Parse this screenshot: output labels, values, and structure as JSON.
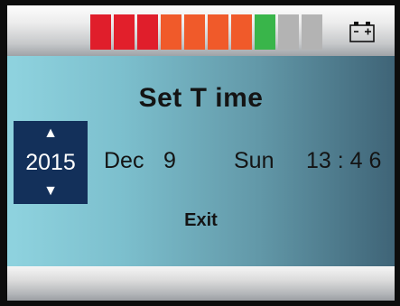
{
  "header": {
    "battery_level_segments": 7,
    "battery_segments_total": 9,
    "segment_colors": [
      "#e01e2b",
      "#e21f2b",
      "#e01e2b",
      "#f05a2a",
      "#f05a2a",
      "#f05a2a",
      "#f05a2a",
      "#39b54a",
      "#b3b3b3",
      "#b3b3b3"
    ],
    "battery_icon": "battery-icon"
  },
  "main": {
    "title": "Set T ime",
    "year": "2015",
    "month": "Dec",
    "day": "9",
    "weekday": "Sun",
    "time": "13 : 4 6",
    "up_arrow": "▲",
    "down_arrow": "▼",
    "exit_label": "Exit"
  }
}
